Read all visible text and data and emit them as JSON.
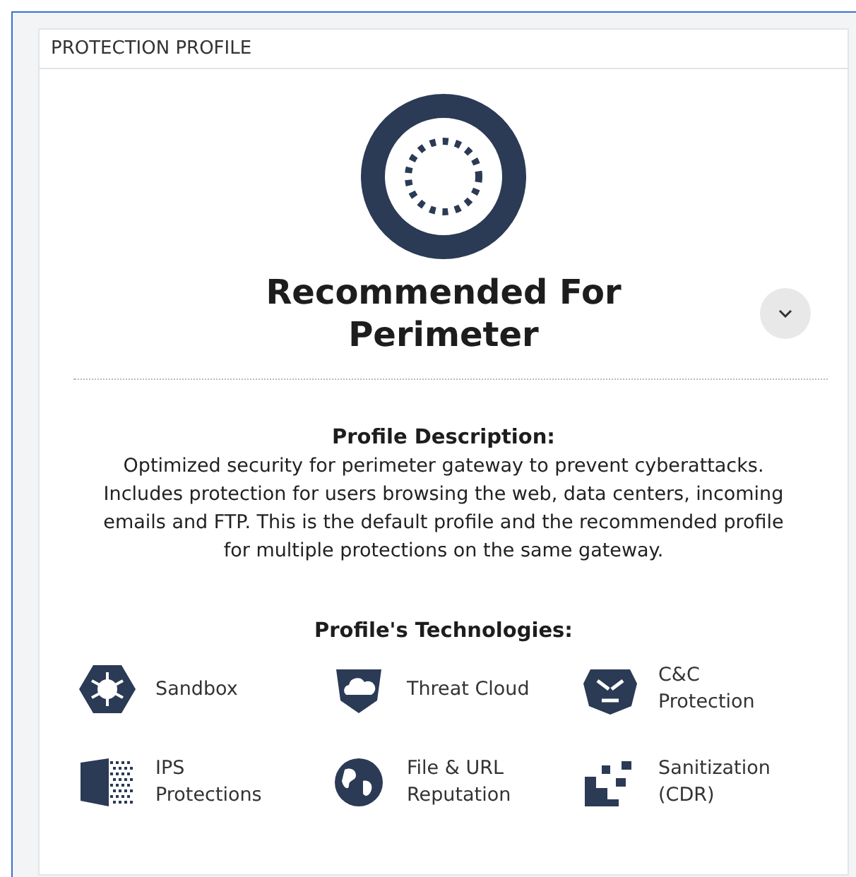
{
  "panel": {
    "title": "PROTECTION PROFILE"
  },
  "profile": {
    "name": "Recommended For Perimeter"
  },
  "description": {
    "heading": "Profile Description:",
    "text": "Optimized security for perimeter gateway to prevent cyberattacks. Includes protection for users browsing the web, data centers, incoming emails and FTP. This is the default profile and the recommended profile for multiple protections on the same gateway."
  },
  "technologies": {
    "heading": "Profile's Technologies:",
    "items": [
      {
        "kind": "sandbox",
        "label": "Sandbox"
      },
      {
        "kind": "cloud",
        "label": "Threat Cloud"
      },
      {
        "kind": "bot",
        "label": "C&C Protection"
      },
      {
        "kind": "ips",
        "label": "IPS Protections"
      },
      {
        "kind": "globe",
        "label": "File & URL Reputation"
      },
      {
        "kind": "cdr",
        "label": "Sanitization (CDR)"
      }
    ]
  }
}
